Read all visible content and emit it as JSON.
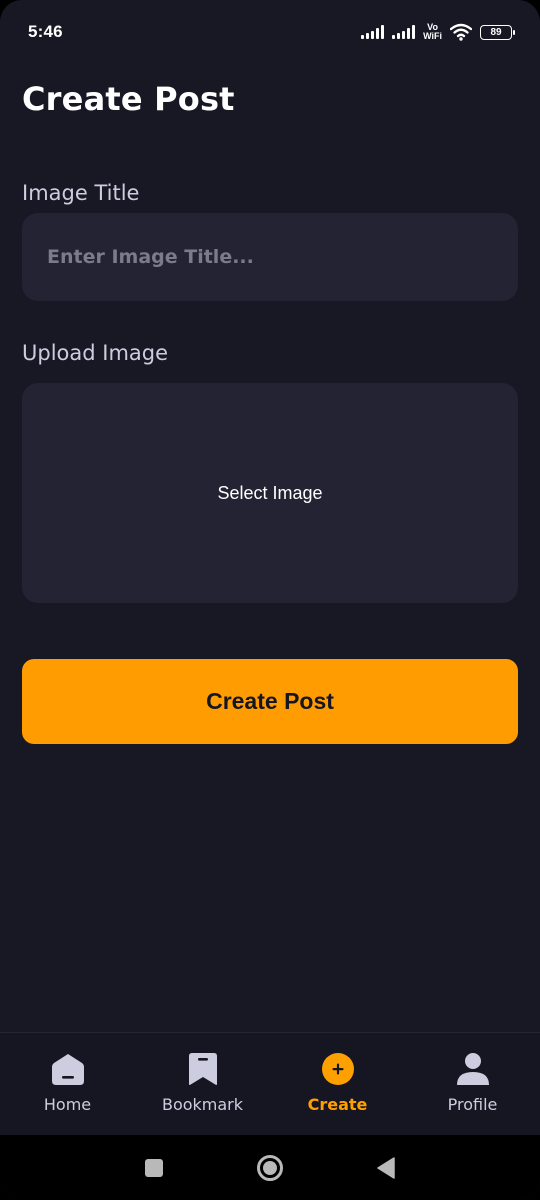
{
  "status_bar": {
    "time": "5:46",
    "vowifi_top": "Vo",
    "vowifi_bottom": "WiFi",
    "battery": "89",
    "icons": [
      "signal-icon",
      "signal-icon",
      "vowifi-icon",
      "wifi-icon",
      "battery-icon"
    ]
  },
  "page": {
    "title": "Create Post"
  },
  "form": {
    "image_title_label": "Image Title",
    "image_title_value": "",
    "image_title_placeholder": "Enter Image Title...",
    "upload_label": "Upload Image",
    "upload_text": "Select Image",
    "submit_label": "Create Post"
  },
  "bottom_nav": {
    "items": [
      {
        "label": "Home",
        "icon": "home-icon",
        "active": false
      },
      {
        "label": "Bookmark",
        "icon": "bookmark-icon",
        "active": false
      },
      {
        "label": "Create",
        "icon": "plus-icon",
        "active": true
      },
      {
        "label": "Profile",
        "icon": "profile-icon",
        "active": false
      }
    ]
  },
  "system_nav": {
    "icons": [
      "recents-icon",
      "home-circle-icon",
      "back-icon"
    ]
  },
  "colors": {
    "background": "#181824",
    "input_bg": "#232333",
    "accent": "#ff9c01",
    "nav_bg": "#161622",
    "label": "#cdcde0"
  }
}
